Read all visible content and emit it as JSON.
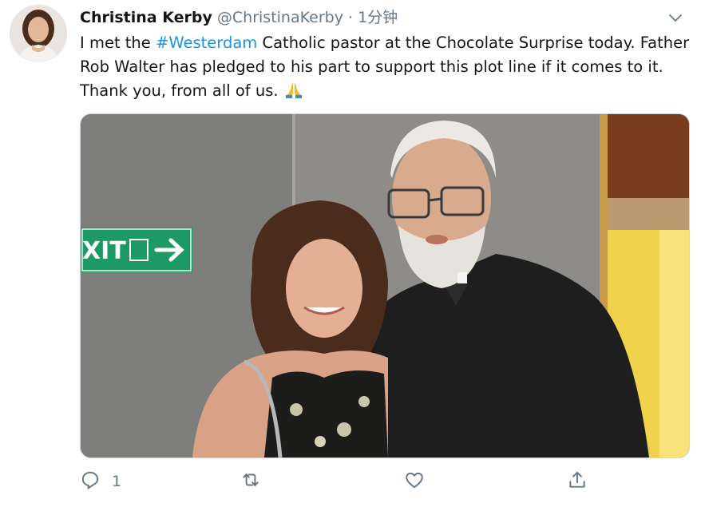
{
  "tweet": {
    "author_name": "Christina Kerby",
    "handle": "@ChristinaKerby",
    "separator": "·",
    "timestamp": "1分钟",
    "text_before": "I met the ",
    "hashtag": "#Westerdam",
    "text_after": " Catholic pastor at the Chocolate Surprise today. Father Rob Walter has pledged to his part to support this plot line if it comes to it. Thank you, from all of us. ",
    "emoji": "folded-hands-emoji",
    "photo_sign_text": "XIT"
  },
  "actions": {
    "reply_count": "1",
    "icons": [
      "reply-icon",
      "retweet-icon",
      "like-icon",
      "share-icon"
    ]
  },
  "colors": {
    "text": "#14171a",
    "muted": "#657786",
    "link": "#1b95e0",
    "border": "#ccd6dd"
  }
}
